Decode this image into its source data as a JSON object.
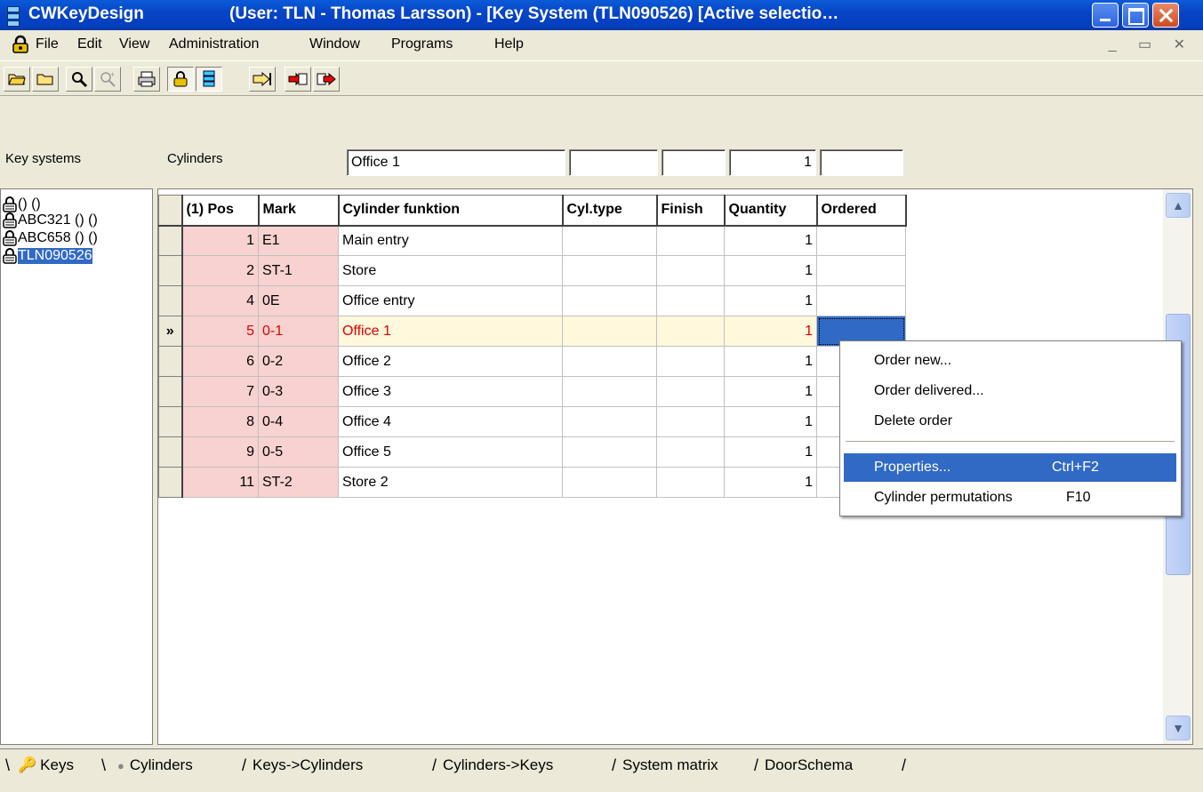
{
  "window": {
    "app_name": "CWKeyDesign",
    "title_rest": "(User: TLN - Thomas Larsson) - [Key System (TLN090526) [Active selectio…"
  },
  "menu": [
    "File",
    "Edit",
    "View",
    "Administration",
    "Window",
    "Programs",
    "Help"
  ],
  "header": {
    "key_systems_label": "Key systems",
    "cylinders_label": "Cylinders",
    "field_name": "Office 1",
    "field_2": "",
    "field_3": "",
    "field_qty": "1",
    "field_5": ""
  },
  "tree": {
    "items": [
      {
        "label": "() ()"
      },
      {
        "label": "ABC321 () ()"
      },
      {
        "label": "ABC658 () ()"
      },
      {
        "label": "TLN090526"
      }
    ]
  },
  "grid": {
    "columns": [
      "(1) Pos",
      "Mark",
      "Cylinder funktion",
      "Cyl.type",
      "Finish",
      "Quantity",
      "Ordered"
    ],
    "rows": [
      {
        "pos": "1",
        "mark": "E1",
        "func": "Main entry",
        "cyl": "",
        "fin": "",
        "qty": "1",
        "ord": ""
      },
      {
        "pos": "2",
        "mark": "ST-1",
        "func": "Store",
        "cyl": "",
        "fin": "",
        "qty": "1",
        "ord": ""
      },
      {
        "pos": "4",
        "mark": "0E",
        "func": "Office entry",
        "cyl": "",
        "fin": "",
        "qty": "1",
        "ord": ""
      },
      {
        "pos": "5",
        "mark": "0-1",
        "func": "Office 1",
        "cyl": "",
        "fin": "",
        "qty": "1",
        "ord": ""
      },
      {
        "pos": "6",
        "mark": "0-2",
        "func": "Office 2",
        "cyl": "",
        "fin": "",
        "qty": "1",
        "ord": ""
      },
      {
        "pos": "7",
        "mark": "0-3",
        "func": "Office 3",
        "cyl": "",
        "fin": "",
        "qty": "1",
        "ord": ""
      },
      {
        "pos": "8",
        "mark": "0-4",
        "func": "Office 4",
        "cyl": "",
        "fin": "",
        "qty": "1",
        "ord": ""
      },
      {
        "pos": "9",
        "mark": "0-5",
        "func": "Office 5",
        "cyl": "",
        "fin": "",
        "qty": "1",
        "ord": ""
      },
      {
        "pos": "11",
        "mark": "ST-2",
        "func": "Store 2",
        "cyl": "",
        "fin": "",
        "qty": "1",
        "ord": ""
      }
    ],
    "active_row_indicator": "»"
  },
  "context_menu": {
    "items": [
      {
        "label": "Order new...",
        "shortcut": ""
      },
      {
        "label": "Order delivered...",
        "shortcut": ""
      },
      {
        "label": "Delete order",
        "shortcut": ""
      },
      {
        "label": "Properties...",
        "shortcut": "Ctrl+F2"
      },
      {
        "label": "Cylinder permutations",
        "shortcut": "F10"
      }
    ]
  },
  "tabs": [
    "Keys",
    "Cylinders",
    "Keys->Cylinders",
    "Cylinders->Keys",
    "System matrix",
    "DoorSchema"
  ],
  "colors": {
    "selection": "#316ac5",
    "title_bar": "#0745c7",
    "pos_column_bg": "#f7d2d0",
    "active_row_text": "#e00000"
  }
}
